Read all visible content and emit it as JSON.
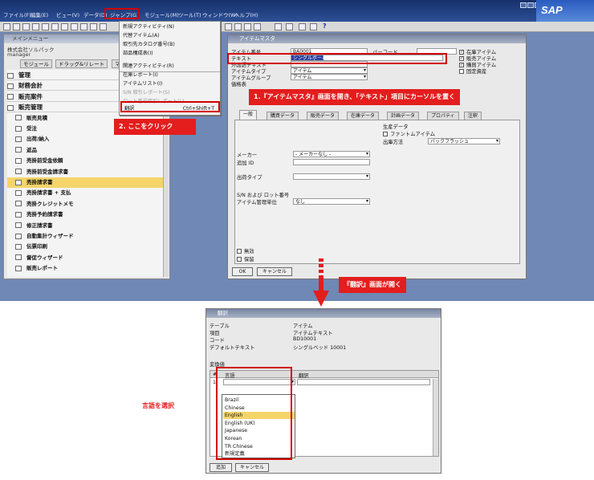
{
  "menubar": {
    "items": [
      "ファイル(F)",
      "編集(E)",
      "ビュー(V)",
      "データ(D)",
      "ジャンプ(G)",
      "モジュール(M)",
      "ツール(T)",
      "ウィンドウ(W)",
      "ヘルプ(H)"
    ]
  },
  "brand": {
    "logo": "SAP"
  },
  "main_menu": {
    "title": "メインメニュー",
    "company": "株式会社ソルパック",
    "user": "manager",
    "tabs": [
      "モジュール",
      "ドラッグ&リレート",
      "マ"
    ],
    "rows": [
      {
        "label": "管理",
        "type": "cat"
      },
      {
        "label": "財務会計",
        "type": "cat"
      },
      {
        "label": "販売案件",
        "type": "cat"
      },
      {
        "label": "販売管理",
        "type": "cat"
      },
      {
        "label": "販売見積",
        "type": "sub"
      },
      {
        "label": "受注",
        "type": "sub"
      },
      {
        "label": "出荷/納入",
        "type": "sub"
      },
      {
        "label": "返品",
        "type": "sub"
      },
      {
        "label": "売掛前受金依頼",
        "type": "sub"
      },
      {
        "label": "売掛前受金請求書",
        "type": "sub"
      },
      {
        "label": "売掛請求書",
        "type": "sub",
        "selected": true
      },
      {
        "label": "売掛請求書 + 支払",
        "type": "sub"
      },
      {
        "label": "売掛クレジットメモ",
        "type": "sub"
      },
      {
        "label": "売掛予約請求書",
        "type": "sub"
      },
      {
        "label": "修正請求書",
        "type": "sub"
      },
      {
        "label": "自動集計ウィザード",
        "type": "sub"
      },
      {
        "label": "伝票印刷",
        "type": "sub"
      },
      {
        "label": "督促ウィザード",
        "type": "sub"
      },
      {
        "label": "販売レポート",
        "type": "sub"
      }
    ]
  },
  "jump_menu": {
    "items": [
      {
        "label": "新規アクティビティ(N)",
        "enabled": true
      },
      {
        "label": "代替アイテム(A)",
        "enabled": true
      },
      {
        "label": "取引先カタログ番号(B)",
        "enabled": true
      },
      {
        "label": "部品構成表(I)",
        "enabled": true
      },
      {
        "label": "関連アクティビティ(R)",
        "enabled": true
      },
      {
        "label": "在庫レポート(I)",
        "enabled": true
      },
      {
        "label": "アイテムリスト(I)",
        "enabled": true
      },
      {
        "label": "S/N 取引レポート(S)",
        "enabled": false
      },
      {
        "label": "ロット番号取引レポート(L)",
        "enabled": false
      }
    ],
    "translate": {
      "label": "翻訳",
      "shortcut": "Ctrl+Shift+T"
    }
  },
  "item_master": {
    "title": "アイテムマスタ",
    "fields": [
      {
        "label": "アイテム番号",
        "value": "BA0001"
      },
      {
        "label": "テキスト",
        "value": "シングルボール"
      },
      {
        "label": "外国語テキスト",
        "value": ""
      },
      {
        "label": "アイテムタイプ",
        "value": "アイテム"
      },
      {
        "label": "アイテムグループ",
        "value": "アイテム"
      },
      {
        "label": "価格表",
        "value": ""
      }
    ],
    "barcode_label": "バーコード",
    "checks": [
      {
        "label": "在庫アイテム",
        "checked": true
      },
      {
        "label": "販売アイテム",
        "checked": true
      },
      {
        "label": "購買アイテム",
        "checked": true
      },
      {
        "label": "固定資産",
        "checked": false
      }
    ],
    "tabs": [
      "一般",
      "購買データ",
      "販売データ",
      "在庫データ",
      "計画データ",
      "プロパティ",
      "注釈"
    ],
    "general": {
      "manufacturer_label": "メーカー",
      "manufacturer_value": "- メーカーなし -",
      "additional_id_label": "追加 ID",
      "shipping_type_label": "出荷タイプ",
      "sn_label": "S/N および ロット番号",
      "mgmt_label": "アイテム管理単位",
      "mgmt_value": "なし",
      "tax_label": "生産データ",
      "phantom_label": "ファントムアイテム",
      "issue_method_label": "出庫方法",
      "issue_method_value": "バックフラッシュ",
      "inactive_label": "無効",
      "hold_label": "保留"
    },
    "ok_label": "OK",
    "cancel_label": "キャンセル"
  },
  "callouts": {
    "step1": "1.『アイテムマスタ』画面を開き、「テキスト」項目にカーソルを置く",
    "step2": "2. ここをクリック",
    "opens": "『翻訳』画面が開く",
    "select_lang": "言語を選択"
  },
  "translation": {
    "title": "翻訳",
    "rows": [
      {
        "label": "テーブル",
        "value": "アイテム"
      },
      {
        "label": "項目",
        "value": "アイテムテキスト"
      },
      {
        "label": "コード",
        "value": "BD10001"
      },
      {
        "label": "デフォルトテキスト",
        "value": "シングルベッド 10001"
      }
    ],
    "section_label": "変換値",
    "columns": [
      "#",
      "言語",
      "翻訳"
    ],
    "row_num": "1",
    "languages": [
      "Brazil",
      "Chinese",
      "English",
      "English (UK)",
      "Japanese",
      "Korean",
      "TR Chinese",
      "新規定義"
    ],
    "selected_language": "English",
    "add_label": "追加",
    "cancel_label": "キャンセル"
  }
}
